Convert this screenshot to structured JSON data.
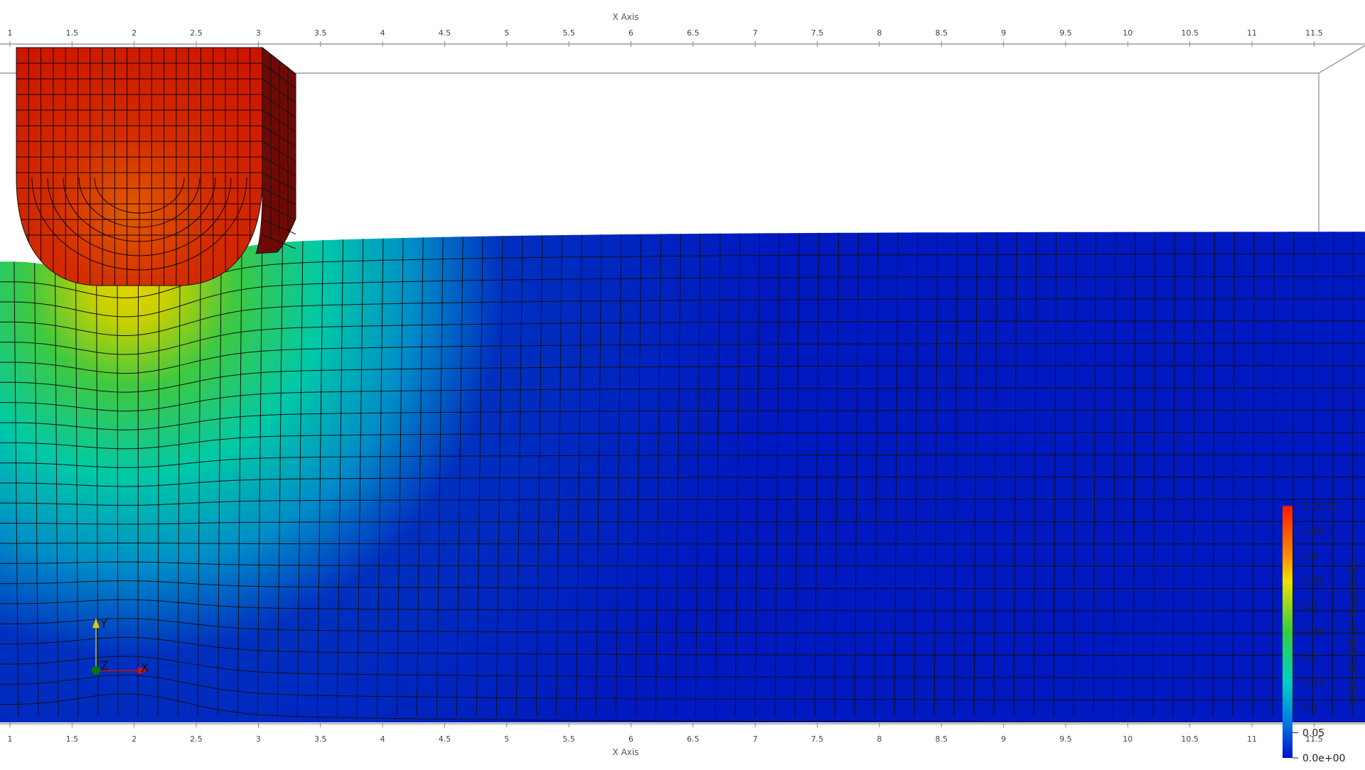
{
  "axes": {
    "title": "X Axis",
    "ticks": [
      "1",
      "1.5",
      "2",
      "2.5",
      "3",
      "3.5",
      "4",
      "4.5",
      "5",
      "5.5",
      "6",
      "6.5",
      "7",
      "7.5",
      "8",
      "8.5",
      "9",
      "9.5",
      "10",
      "10.5",
      "11",
      "11.5"
    ]
  },
  "orientation": {
    "y_label": "Y",
    "z_label": "Z",
    "x_label": "X"
  },
  "colorbar": {
    "title": "DISPLACEMENT Magnitude",
    "labels": [
      "5.0e-01",
      "0.45",
      "0.4",
      "0.35",
      "0.3",
      "0.25",
      "0.2",
      "0.15",
      "0.1",
      "0.05",
      "0.0e+00"
    ],
    "range": [
      0,
      0.5
    ]
  },
  "colors": {
    "indenter": "#cc1100",
    "indenter_side": "#6e0a05",
    "low": "#0019c8",
    "mid": "#00c8a0",
    "high": "#e8c800"
  }
}
